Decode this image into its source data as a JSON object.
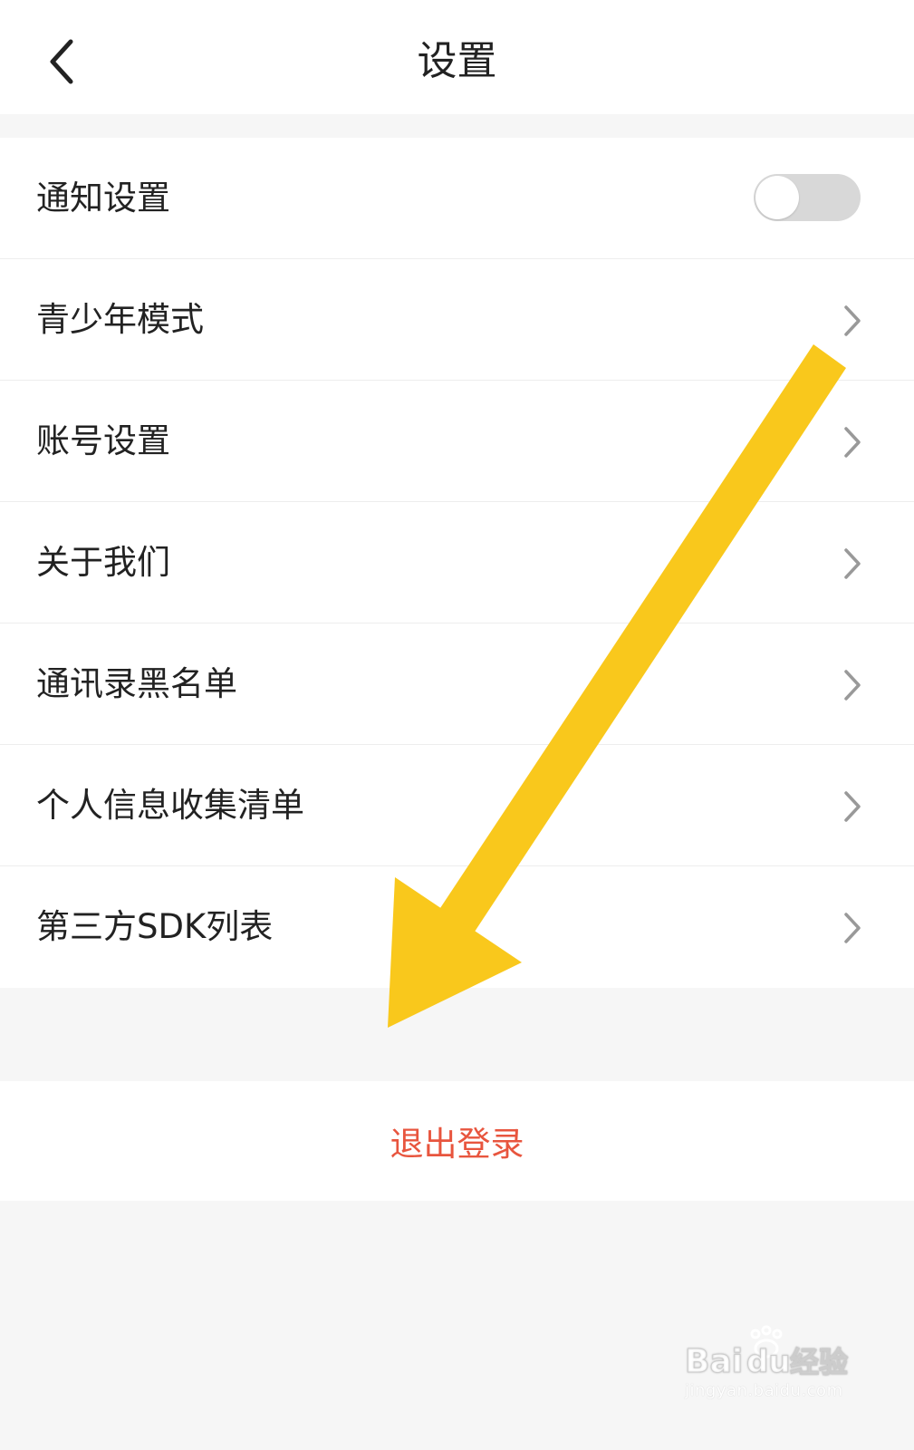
{
  "header": {
    "title": "设置",
    "back_icon": "chevron-left-icon"
  },
  "settings": {
    "items": [
      {
        "label": "通知设置",
        "control": "toggle",
        "toggle_on": false
      },
      {
        "label": "青少年模式",
        "control": "chevron"
      },
      {
        "label": "账号设置",
        "control": "chevron"
      },
      {
        "label": "关于我们",
        "control": "chevron"
      },
      {
        "label": "通讯录黑名单",
        "control": "chevron"
      },
      {
        "label": "个人信息收集清单",
        "control": "chevron"
      },
      {
        "label": "第三方SDK列表",
        "control": "chevron"
      }
    ]
  },
  "logout": {
    "label": "退出登录"
  },
  "overlay": {
    "annotation": "arrow",
    "color": "#f9c81c"
  },
  "watermark": {
    "logo": "Baidu经验",
    "url": "jingyan.baidu.com"
  },
  "colors": {
    "background": "#f6f6f6",
    "logout_text": "#e8553e",
    "toggle_off": "#d8d8d8"
  }
}
